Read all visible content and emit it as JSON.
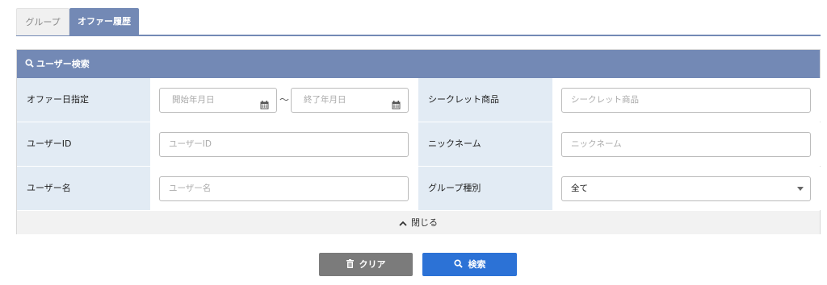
{
  "tabs": [
    {
      "label": "グループ",
      "active": false
    },
    {
      "label": "オファー履歴",
      "active": true
    }
  ],
  "panel": {
    "title": "ユーザー検索",
    "title_icon": "search-icon",
    "fields": {
      "offer_date": {
        "label": "オファー日指定",
        "start_placeholder": "開始年月日",
        "end_placeholder": "終了年月日",
        "separator": "～",
        "icon": "calendar-icon"
      },
      "secret_product": {
        "label": "シークレット商品",
        "placeholder": "シークレット商品"
      },
      "user_id": {
        "label": "ユーザーID",
        "placeholder": "ユーザーID"
      },
      "nickname": {
        "label": "ニックネーム",
        "placeholder": "ニックネーム"
      },
      "user_name": {
        "label": "ユーザー名",
        "placeholder": "ユーザー名"
      },
      "group_type": {
        "label": "グループ種別",
        "selected": "全て"
      }
    },
    "close_label": "閉じる"
  },
  "buttons": {
    "clear_label": "クリア",
    "search_label": "検索"
  },
  "colors": {
    "accent": "#7389b5",
    "label_bg": "#e2ebf4",
    "search_button": "#2c72d6",
    "clear_button": "#7b7b7b"
  }
}
